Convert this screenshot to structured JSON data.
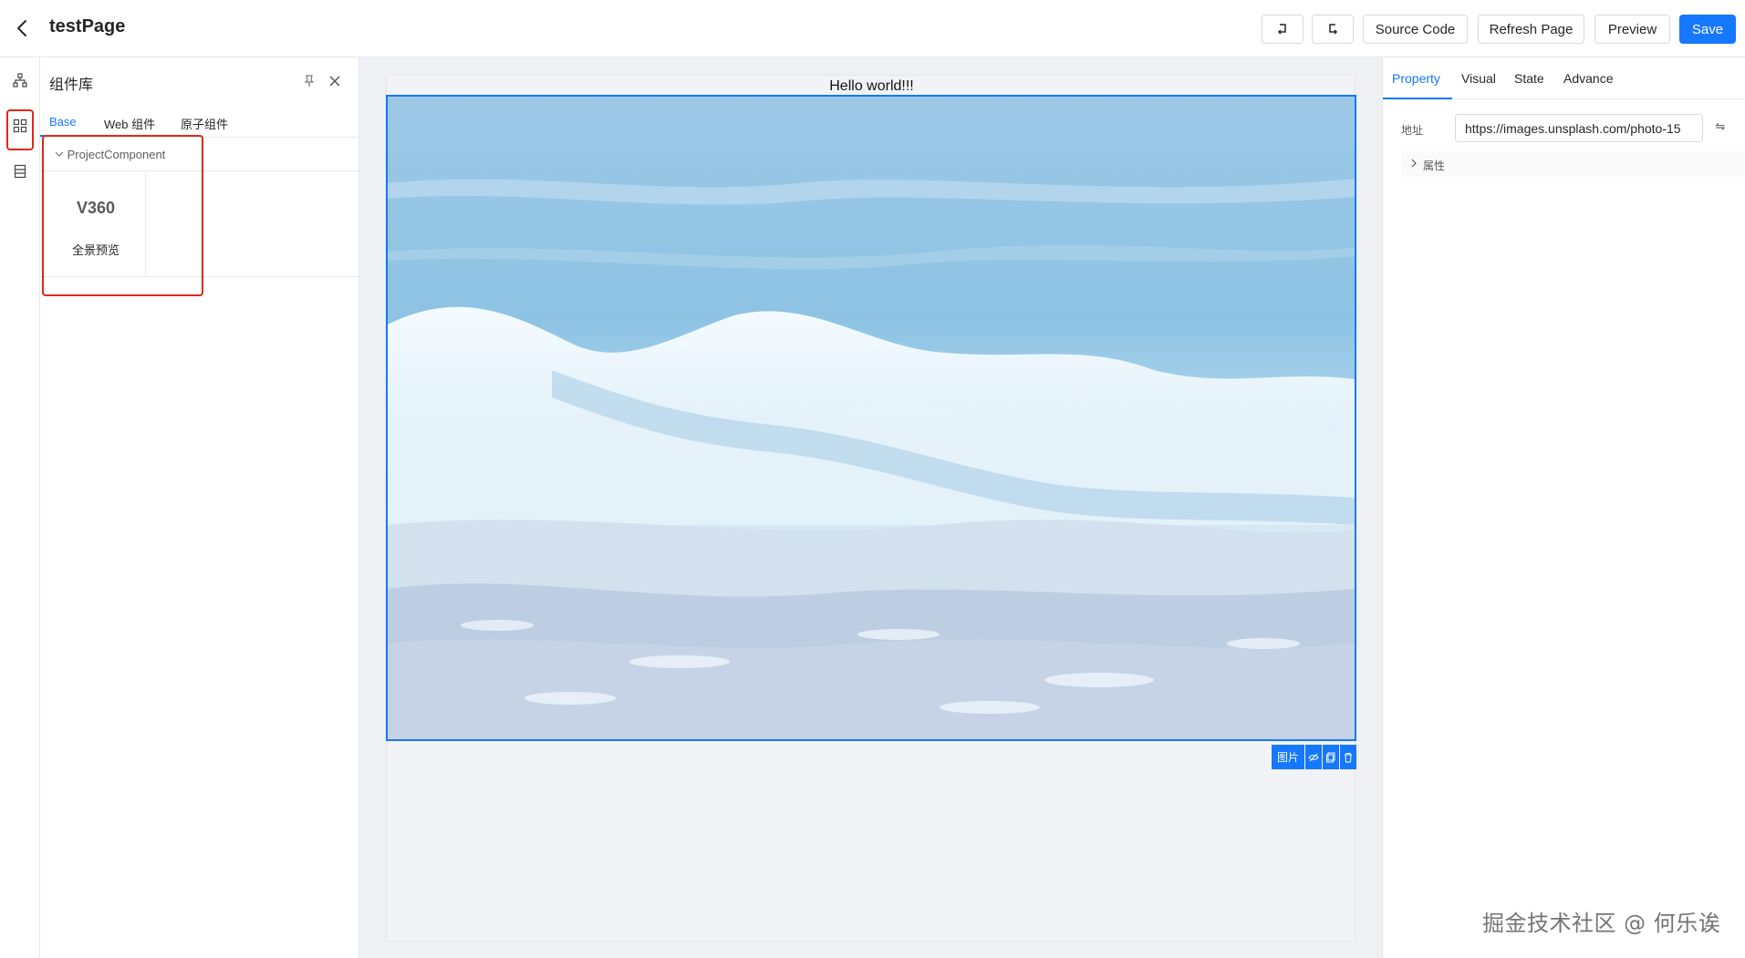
{
  "header": {
    "title": "testPage",
    "undo_icon": "undo-icon",
    "redo_icon": "redo-icon",
    "source_code": "Source Code",
    "refresh_page": "Refresh Page",
    "preview": "Preview",
    "save": "Save"
  },
  "rail": {
    "items": [
      {
        "icon": "sitemap-icon"
      },
      {
        "icon": "components-icon"
      },
      {
        "icon": "data-source-icon"
      }
    ]
  },
  "component_panel": {
    "title": "组件库",
    "tabs": [
      "Base",
      "Web 组件",
      "原子组件"
    ],
    "group_title": "ProjectComponent",
    "components": [
      {
        "logo": "V360",
        "name": "全景预览"
      }
    ]
  },
  "canvas": {
    "text_block": "Hello world!!!",
    "selection_label": "图片"
  },
  "property_panel": {
    "tabs": [
      "Property",
      "Visual",
      "State",
      "Advance"
    ],
    "address_label": "地址",
    "address_value": "https://images.unsplash.com/photo-15",
    "swap_icon": "⇋",
    "section_label": "属性"
  },
  "watermark": "掘金技术社区 @ 何乐诶",
  "colors": {
    "primary": "#1677ff",
    "highlight": "#e0281c",
    "canvas_bg": "#eef0f4"
  }
}
